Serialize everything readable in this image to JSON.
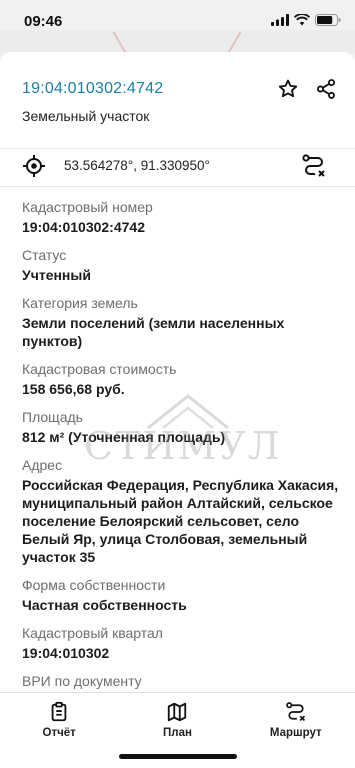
{
  "status_bar": {
    "time": "09:46",
    "battery_level": 0.8
  },
  "header": {
    "cadastral_number": "19:04:010302:4742",
    "object_type": "Земельный участок"
  },
  "coords": {
    "text": "53.564278°, 91.330950°"
  },
  "fields": [
    {
      "label": "Кадастровый номер",
      "value": "19:04:010302:4742"
    },
    {
      "label": "Статус",
      "value": "Учтенный"
    },
    {
      "label": "Категория земель",
      "value": "Земли поселений (земли населенных пунктов)"
    },
    {
      "label": "Кадастровая стоимость",
      "value": "158 656,68 руб."
    },
    {
      "label": "Площадь",
      "value": "812 м² (Уточненная площадь)"
    },
    {
      "label": "Адрес",
      "value": "Российская Федерация, Республика Хакасия, муниципальный район Алтайский, сельское поселение Белоярский сельсовет, село Белый Яр, улица Столбовая, земельный участок 35"
    },
    {
      "label": "Форма собственности",
      "value": "Частная собственность"
    },
    {
      "label": "Кадастровый квартал",
      "value": "19:04:010302"
    },
    {
      "label": "ВРИ по документу",
      "value": ""
    }
  ],
  "watermark": {
    "text": "СТИМУЛ"
  },
  "bottom_nav": [
    {
      "label": "Отчёт",
      "icon": "report-icon"
    },
    {
      "label": "План",
      "icon": "map-icon"
    },
    {
      "label": "Маршрут",
      "icon": "route-icon"
    }
  ],
  "colors": {
    "accent": "#1b7fa6",
    "label": "#6e6e6e"
  }
}
